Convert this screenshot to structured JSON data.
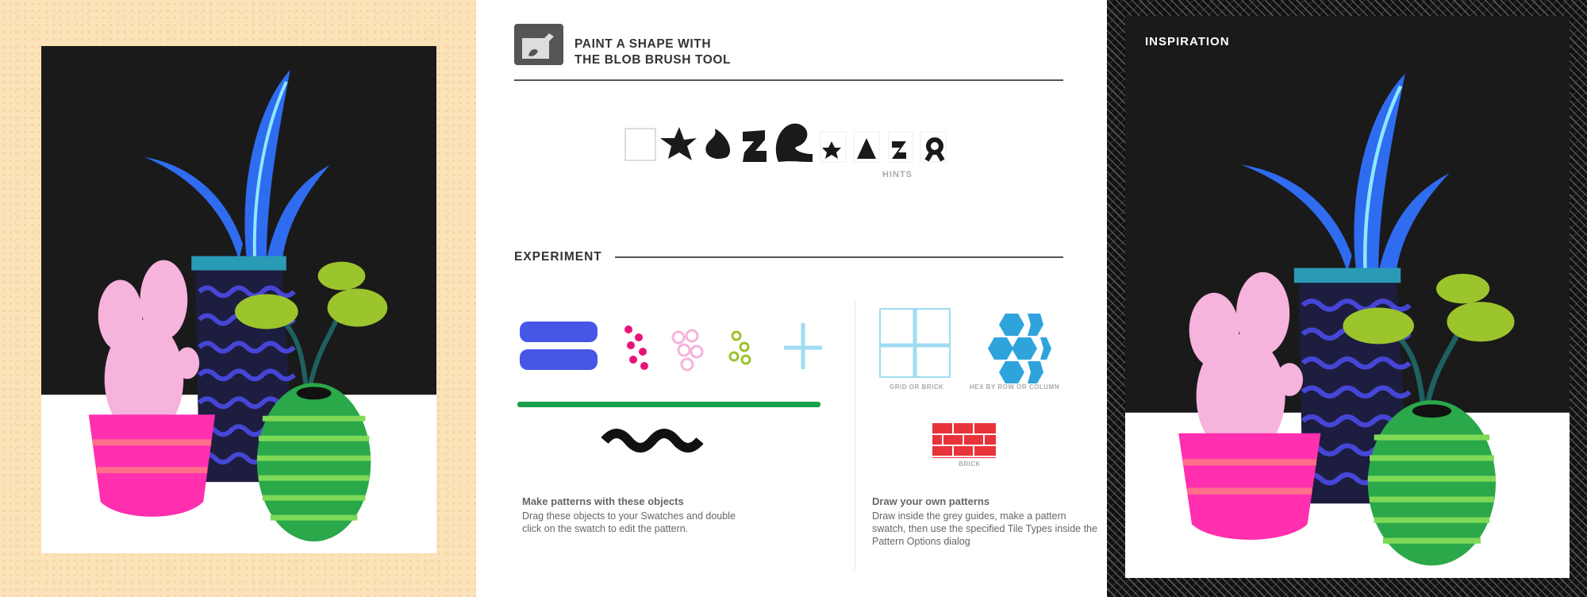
{
  "left_panel": {
    "name": "artwork-in-progress"
  },
  "header": {
    "icon": "blob-brush-icon",
    "title_line1": "PAINT A SHAPE WITH",
    "title_line2": "THE BLOB BRUSH TOOL"
  },
  "hints": {
    "label": "HINTS"
  },
  "experiment": {
    "heading": "EXPERIMENT",
    "objects_title": "Make patterns with these objects",
    "objects_text": "Drag these objects to your Swatches and double click on the swatch to edit the pattern.",
    "own_title": "Draw your own patterns",
    "own_text": "Draw inside the grey guides, make a pattern swatch, then use the specified Tile Types inside the Pattern Options dialog",
    "tile_labels": [
      "GRID OR BRICK",
      "HEX BY ROW OR COLUMN",
      "BRICK"
    ]
  },
  "inspiration": {
    "label": "INSPIRATION"
  },
  "colors": {
    "blue": "#4657e8",
    "pink": "#e8137a",
    "green": "#18a04a",
    "cyan": "#9fdcf2",
    "hex": "#2ea3dc",
    "brick": "#e8333a"
  }
}
